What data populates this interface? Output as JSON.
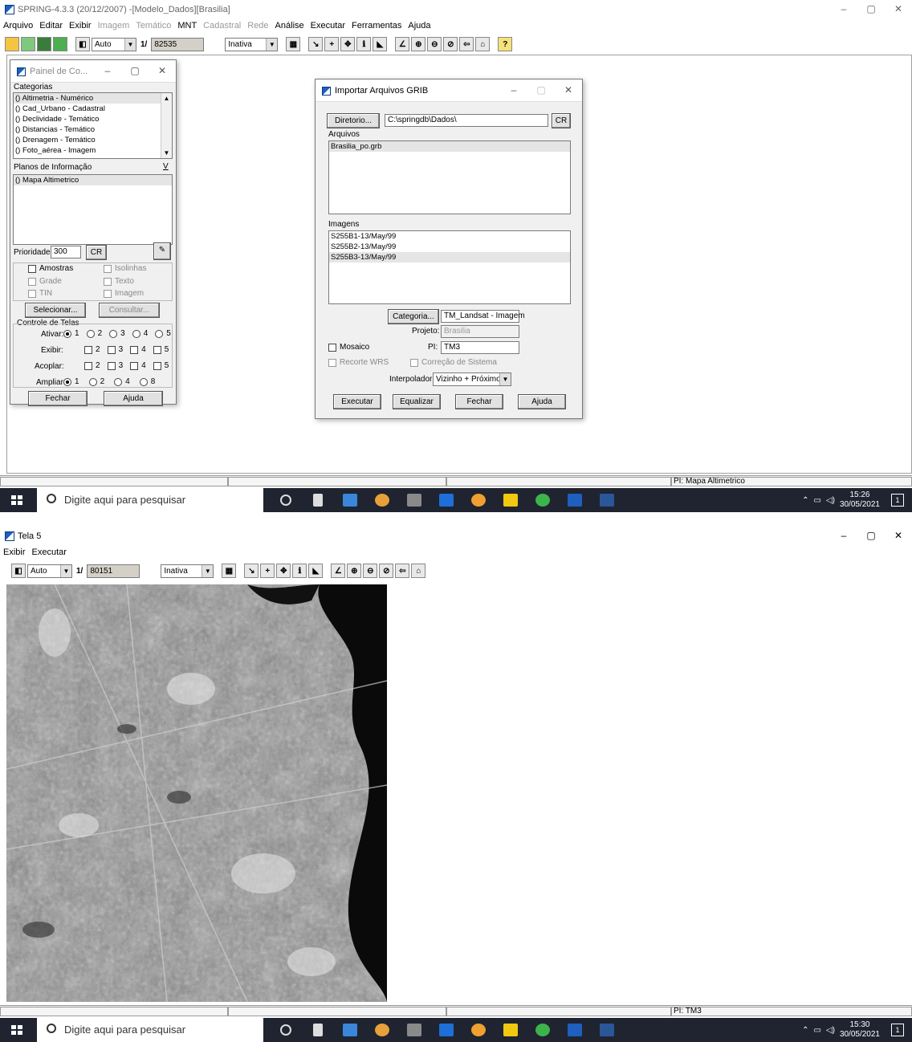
{
  "screen1": {
    "title": "SPRING-4.3.3 (20/12/2007) -[Modelo_Dados][Brasilia]",
    "window_controls": [
      "–",
      "▢",
      "✕"
    ],
    "menu": [
      {
        "label": "Arquivo",
        "enabled": true
      },
      {
        "label": "Editar",
        "enabled": true
      },
      {
        "label": "Exibir",
        "enabled": true
      },
      {
        "label": "Imagem",
        "enabled": false
      },
      {
        "label": "Temático",
        "enabled": false
      },
      {
        "label": "MNT",
        "enabled": true
      },
      {
        "label": "Cadastral",
        "enabled": false
      },
      {
        "label": "Rede",
        "enabled": false
      },
      {
        "label": "Análise",
        "enabled": true
      },
      {
        "label": "Executar",
        "enabled": true
      },
      {
        "label": "Ferramentas",
        "enabled": true
      },
      {
        "label": "Ajuda",
        "enabled": true
      }
    ],
    "toolbar": {
      "zoom_mode": "Auto",
      "scale_prefix": "1/",
      "scale_value": "82535",
      "status_combo": "Inativa"
    },
    "panel": {
      "title": "Painel de Co...",
      "categorias_label": "Categorias",
      "categorias": [
        "() Altimetria - Numérico",
        "() Cad_Urbano - Cadastral",
        "() Declividade - Temático",
        "() Distancias - Temático",
        "() Drenagem - Temático",
        "() Foto_aérea - Imagem"
      ],
      "planos_label": "Planos de Informação",
      "planos_btn": "V",
      "planos": [
        "() Mapa Altimetrico"
      ],
      "prioridade_label": "Prioridade:",
      "prioridade_value": "300",
      "cr": "CR",
      "checks": [
        {
          "label": "Amostras",
          "enabled": true
        },
        {
          "label": "Isolinhas",
          "enabled": false
        },
        {
          "label": "Grade",
          "enabled": false
        },
        {
          "label": "Texto",
          "enabled": false
        },
        {
          "label": "TIN",
          "enabled": false
        },
        {
          "label": "Imagem",
          "enabled": false
        }
      ],
      "selecionar": "Selecionar...",
      "consultar": "Consultar...",
      "controle_label": "Controle de Telas",
      "ativar_label": "Ativar:",
      "exibir_label": "Exibir:",
      "acoplar_label": "Acoplar:",
      "ampliar_label": "Ampliar:",
      "nums": [
        "1",
        "2",
        "3",
        "4",
        "5"
      ],
      "ampliar_nums": [
        "1",
        "2",
        "4",
        "8"
      ],
      "fechar": "Fechar",
      "ajuda": "Ajuda"
    },
    "dialog": {
      "title": "Importar Arquivos GRIB",
      "diretorio_btn": "Diretorio...",
      "diretorio_value": "C:\\springdb\\Dados\\",
      "cr": "CR",
      "arquivos_label": "Arquivos",
      "arquivos": [
        "Brasilia_po.grb"
      ],
      "imagens_label": "Imagens",
      "imagens": [
        "S255B1-13/May/99",
        "S255B2-13/May/99",
        "S255B3-13/May/99"
      ],
      "categoria_btn": "Categoria...",
      "categoria_value": "TM_Landsat - Imagem",
      "projeto_label": "Projeto:",
      "projeto_value": "Brasilia",
      "mosaico": "Mosaico",
      "pi_label": "PI:",
      "pi_value": "TM3",
      "recorte": "Recorte WRS",
      "correcao": "Correção de Sistema",
      "interpolador_label": "Interpolador:",
      "interpolador_value": "Vizinho + Próximo",
      "executar": "Executar",
      "equalizar": "Equalizar",
      "fechar": "Fechar",
      "ajuda": "Ajuda"
    },
    "status_pi": "PI: Mapa Altimetrico",
    "clock_time": "15:26",
    "clock_date": "30/05/2021"
  },
  "screen2": {
    "title": "Tela 5",
    "window_controls": [
      "–",
      "▢",
      "✕"
    ],
    "menu": [
      {
        "label": "Exibir"
      },
      {
        "label": "Executar"
      }
    ],
    "toolbar": {
      "zoom_mode": "Auto",
      "scale_prefix": "1/",
      "scale_value": "80151",
      "status_combo": "Inativa"
    },
    "status_pi": "PI: TM3",
    "clock_time": "15:30",
    "clock_date": "30/05/2021"
  },
  "taskbar": {
    "search_placeholder": "Digite aqui para pesquisar",
    "app_colors": [
      "#dddddd",
      "#dddddd",
      "#3a87d9",
      "#e8a13a",
      "#8a8a8a",
      "#1e6fd9",
      "#f0a030",
      "#f2c811",
      "#3cb44b",
      "#1f5fbf",
      "#2b579a"
    ]
  },
  "colors": {
    "accent": "#1d5fbf",
    "window_bg": "#f0f0f0",
    "taskbar": "#1f2430"
  }
}
